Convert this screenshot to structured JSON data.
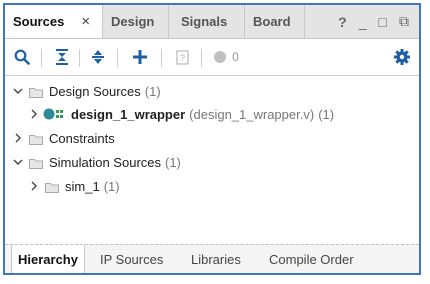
{
  "tabs": {
    "sources": "Sources",
    "close": "×",
    "design": "Design",
    "signals": "Signals",
    "board": "Board"
  },
  "window_controls": {
    "help": "?",
    "minimize": "_",
    "restore": "□",
    "float": "⧉"
  },
  "toolbar": {
    "badge_count": "0"
  },
  "tree": {
    "design_sources": {
      "label": "Design Sources",
      "count": "(1)"
    },
    "wrapper": {
      "label": "design_1_wrapper",
      "file": "(design_1_wrapper.v)",
      "count": "(1)"
    },
    "constraints": {
      "label": "Constraints"
    },
    "simulation_sources": {
      "label": "Simulation Sources",
      "count": "(1)"
    },
    "sim_1": {
      "label": "sim_1",
      "count": "(1)"
    }
  },
  "bottom_tabs": [
    "Hierarchy",
    "IP Sources",
    "Libraries",
    "Compile Order"
  ],
  "colors": {
    "frame": "#3f74c6",
    "accent_blue": "#1f5fa8",
    "teal": "#2f8a99",
    "green": "#3a9d4a"
  }
}
